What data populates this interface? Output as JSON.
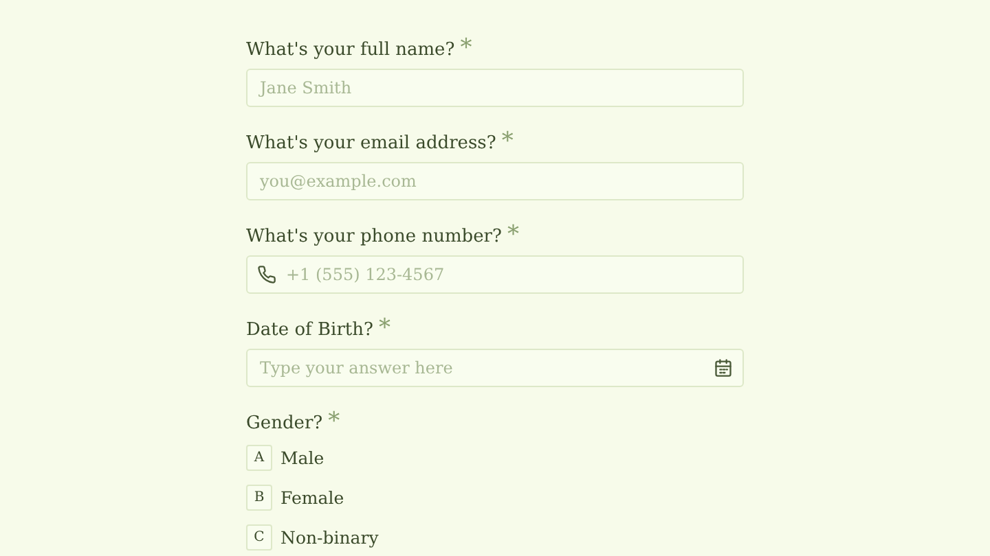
{
  "questions": [
    {
      "kind": "text",
      "label": "What's your full name?",
      "required_mark": "*",
      "placeholder": "Jane Smith"
    },
    {
      "kind": "text",
      "label": "What's your email address?",
      "required_mark": "*",
      "placeholder": "you@example.com"
    },
    {
      "kind": "phone",
      "label": "What's your phone number?",
      "required_mark": "*",
      "placeholder": "+1 (555) 123-4567"
    },
    {
      "kind": "date",
      "label": "Date of Birth?",
      "required_mark": "*",
      "placeholder": "Type your answer here"
    },
    {
      "kind": "choice",
      "label": "Gender?",
      "required_mark": "*",
      "options": [
        {
          "key": "A",
          "label": "Male",
          "selected": false
        },
        {
          "key": "B",
          "label": "Female",
          "selected": false
        },
        {
          "key": "C",
          "label": "Non-binary",
          "selected": false
        }
      ]
    }
  ]
}
